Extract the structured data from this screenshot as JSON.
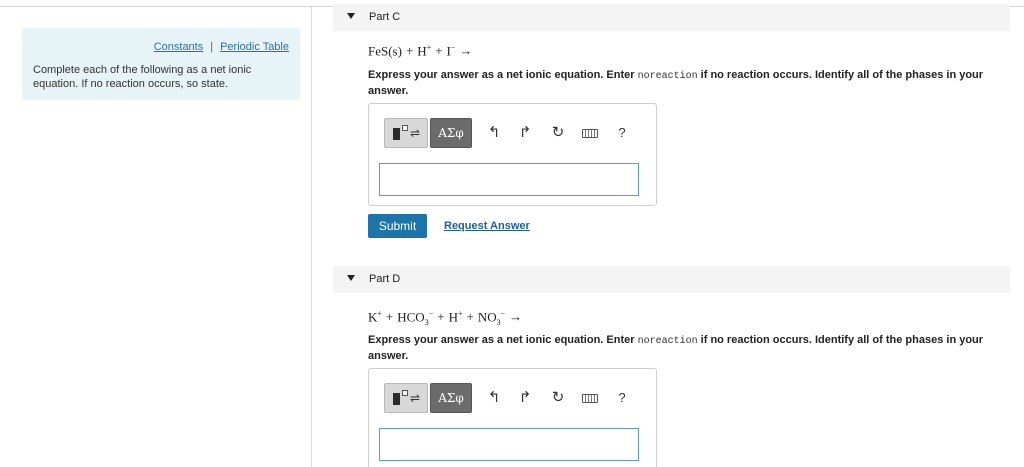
{
  "sidebar": {
    "links": [
      "Constants",
      "Periodic Table"
    ],
    "separator": "|",
    "instructions": "Complete each of the following as a net ionic equation. If no reaction occurs, so state."
  },
  "parts": [
    {
      "title": "Part C",
      "equation": {
        "t1": "FeS(s)",
        "op1": "+",
        "t2": "H",
        "t2_sup": "+",
        "op2": "+",
        "t3": "I",
        "t3_sup": "−",
        "arrow": "→"
      },
      "instr_before": "Express your answer as a net ionic equation. Enter ",
      "instr_code": "noreaction",
      "instr_after": " if no reaction occurs. Identify all of the phases in your answer.",
      "submit_label": "Submit",
      "request_label": "Request Answer"
    },
    {
      "title": "Part D",
      "equation": {
        "t1": "K",
        "t1_sup": "+",
        "op1": "+",
        "t2": "HCO",
        "t2_sub": "3",
        "t2_sup": "−",
        "op2": "+",
        "t3": "H",
        "t3_sup": "+",
        "op3": "+",
        "t4": "NO",
        "t4_sub": "3",
        "t4_sup": "−",
        "arrow": "→"
      },
      "instr_before": "Express your answer as a net ionic equation. Enter ",
      "instr_code": "noreaction",
      "instr_after": " if no reaction occurs. Identify all of the phases in your answer."
    }
  ],
  "toolbar": {
    "greek_label": "ΑΣφ",
    "undo_glyph": "↰",
    "redo_glyph": "↱",
    "reset_glyph": "↻",
    "help_label": "?"
  },
  "colors": {
    "sidebar_bg": "#e6f3f7",
    "link": "#2b6fa6",
    "submit_bg": "#1d74a8",
    "input_border": "#5e9bc8"
  }
}
